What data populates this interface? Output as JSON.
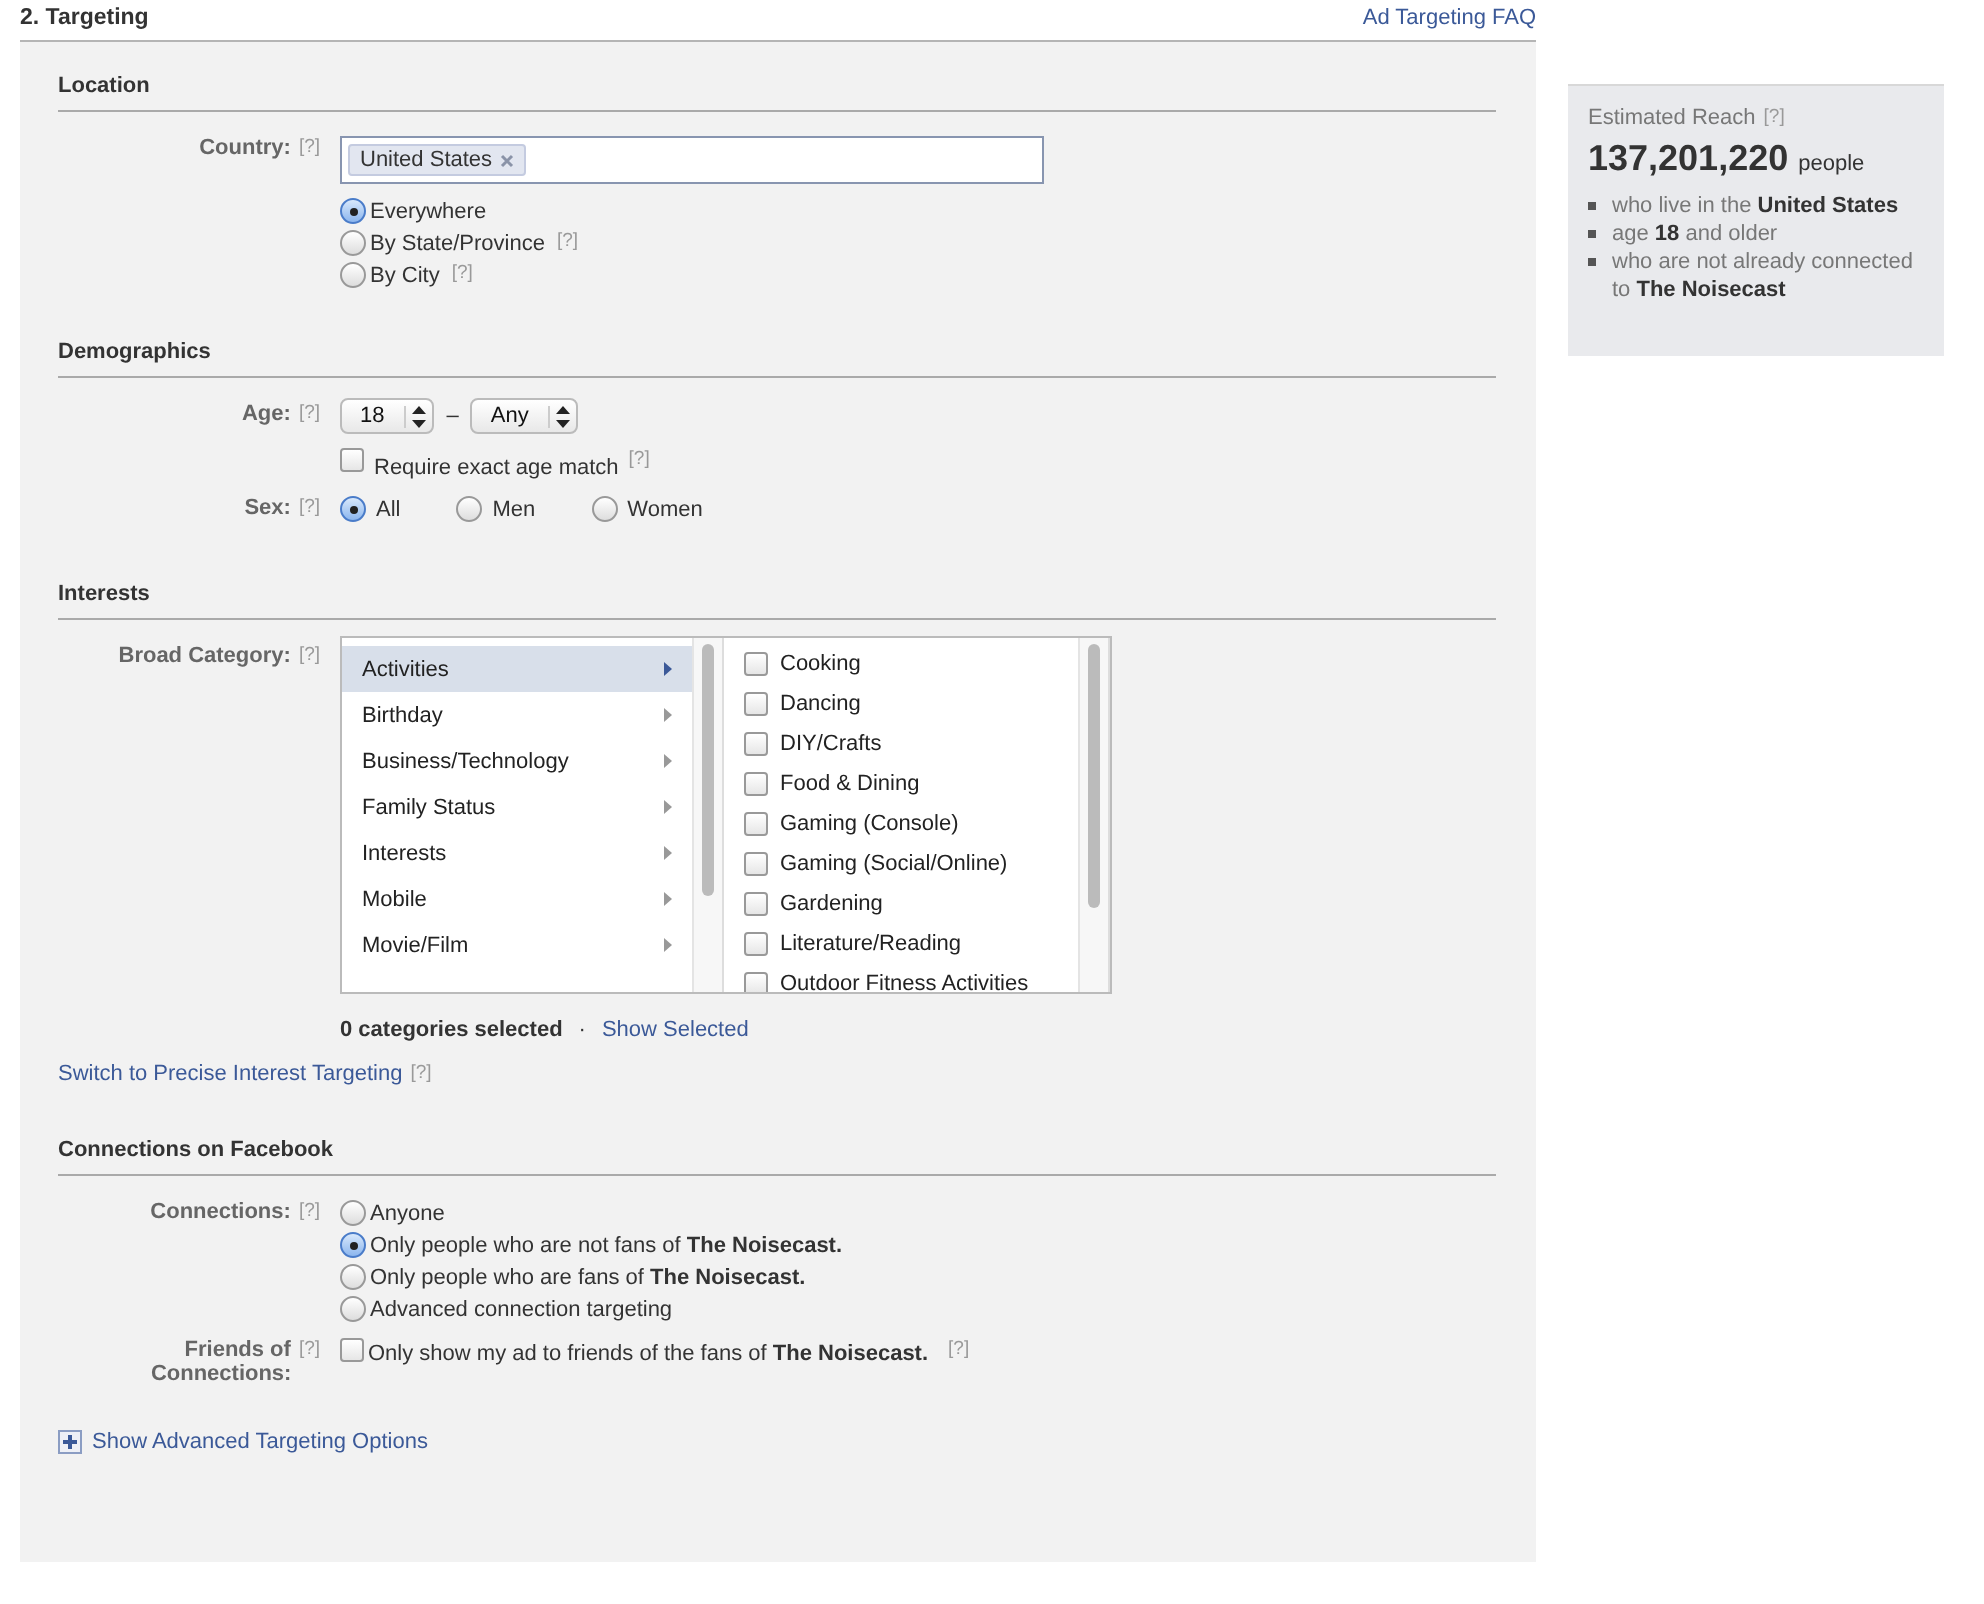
{
  "header": {
    "title": "2. Targeting",
    "faq_link": "Ad Targeting FAQ"
  },
  "location": {
    "heading": "Location",
    "country": {
      "label": "Country:",
      "help": "[?]",
      "tokens": [
        "United States"
      ]
    },
    "options": [
      {
        "label": "Everywhere",
        "selected": true
      },
      {
        "label": "By State/Province",
        "help": "[?]",
        "selected": false
      },
      {
        "label": "By City",
        "help": "[?]",
        "selected": false
      }
    ]
  },
  "demographics": {
    "heading": "Demographics",
    "age": {
      "label": "Age:",
      "help": "[?]",
      "from": "18",
      "separator": "–",
      "to": "Any"
    },
    "exact_match": {
      "label": "Require exact age match",
      "help": "[?]",
      "checked": false
    },
    "sex": {
      "label": "Sex:",
      "help": "[?]",
      "options": [
        {
          "label": "All",
          "selected": true
        },
        {
          "label": "Men",
          "selected": false
        },
        {
          "label": "Women",
          "selected": false
        }
      ]
    }
  },
  "interests": {
    "heading": "Interests",
    "broad_category": {
      "label": "Broad Category:",
      "help": "[?]",
      "categories": [
        {
          "label": "Activities",
          "selected": true
        },
        {
          "label": "Birthday",
          "selected": false
        },
        {
          "label": "Business/Technology",
          "selected": false
        },
        {
          "label": "Family Status",
          "selected": false
        },
        {
          "label": "Interests",
          "selected": false
        },
        {
          "label": "Mobile",
          "selected": false
        },
        {
          "label": "Movie/Film",
          "selected": false
        }
      ],
      "subcategories": [
        {
          "label": "Cooking",
          "checked": false
        },
        {
          "label": "Dancing",
          "checked": false
        },
        {
          "label": "DIY/Crafts",
          "checked": false
        },
        {
          "label": "Food & Dining",
          "checked": false
        },
        {
          "label": "Gaming (Console)",
          "checked": false
        },
        {
          "label": "Gaming (Social/Online)",
          "checked": false
        },
        {
          "label": "Gardening",
          "checked": false
        },
        {
          "label": "Literature/Reading",
          "checked": false
        },
        {
          "label": "Outdoor Fitness Activities",
          "checked": false
        }
      ],
      "count": "0 categories selected",
      "separator": "·",
      "show_selected": "Show Selected"
    },
    "switch_link": {
      "label": "Switch to Precise Interest Targeting",
      "help": "[?]"
    }
  },
  "connections": {
    "heading": "Connections on Facebook",
    "connections": {
      "label": "Connections:",
      "help": "[?]",
      "options": [
        {
          "label": "Anyone",
          "selected": false
        },
        {
          "label": "Only people who are not fans of **The Noisecast.**",
          "selected": true
        },
        {
          "label": "Only people who are fans of **The Noisecast.**",
          "selected": false
        },
        {
          "label": "Advanced connection targeting",
          "selected": false
        }
      ]
    },
    "friends": {
      "label": "Friends of Connections:",
      "text": "Only show my ad to friends of the fans of **The Noisecast.**",
      "help": "[?]",
      "checked": false
    }
  },
  "advanced_link": "Show Advanced Targeting Options",
  "reach": {
    "title": "Estimated Reach",
    "help": "[?]",
    "count": "137,201,220",
    "unit": "people",
    "items": [
      "who live in the **United States**",
      "age **18** and older",
      "who are not already connected to **The Noisecast**"
    ]
  }
}
